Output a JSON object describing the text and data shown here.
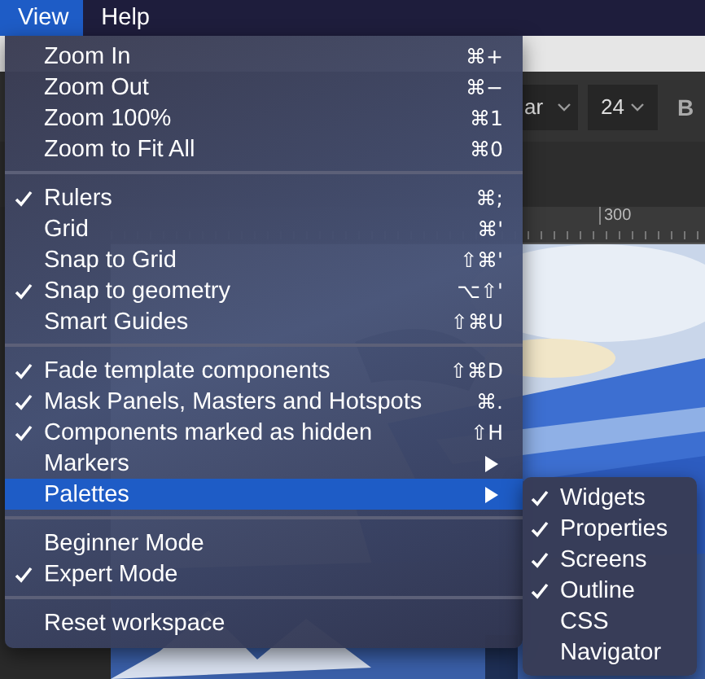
{
  "menubar": [
    {
      "label": "View",
      "selected": true
    },
    {
      "label": "Help",
      "selected": false
    }
  ],
  "toolbar": {
    "font_field": "ar",
    "size_field": "24",
    "bold_button": "B"
  },
  "ruler": {
    "label": "300"
  },
  "menu": {
    "sections": [
      [
        {
          "label": "Zoom In",
          "shortcut": "⌘+",
          "checked": false,
          "has_submenu": false,
          "selected": false
        },
        {
          "label": "Zoom Out",
          "shortcut": "⌘−",
          "checked": false,
          "has_submenu": false,
          "selected": false
        },
        {
          "label": "Zoom 100%",
          "shortcut": "⌘1",
          "checked": false,
          "has_submenu": false,
          "selected": false
        },
        {
          "label": "Zoom to Fit All",
          "shortcut": "⌘0",
          "checked": false,
          "has_submenu": false,
          "selected": false
        }
      ],
      [
        {
          "label": "Rulers",
          "shortcut": "⌘;",
          "checked": true,
          "has_submenu": false,
          "selected": false
        },
        {
          "label": "Grid",
          "shortcut": "⌘'",
          "checked": false,
          "has_submenu": false,
          "selected": false
        },
        {
          "label": "Snap to Grid",
          "shortcut": "⇧⌘'",
          "checked": false,
          "has_submenu": false,
          "selected": false
        },
        {
          "label": "Snap to geometry",
          "shortcut": "⌥⇧'",
          "checked": true,
          "has_submenu": false,
          "selected": false
        },
        {
          "label": "Smart Guides",
          "shortcut": "⇧⌘U",
          "checked": false,
          "has_submenu": false,
          "selected": false
        }
      ],
      [
        {
          "label": "Fade template components",
          "shortcut": "⇧⌘D",
          "checked": true,
          "has_submenu": false,
          "selected": false
        },
        {
          "label": "Mask Panels, Masters and Hotspots",
          "shortcut": "⌘.",
          "checked": true,
          "has_submenu": false,
          "selected": false
        },
        {
          "label": "Components marked as hidden",
          "shortcut": "⇧H",
          "checked": true,
          "has_submenu": false,
          "selected": false
        },
        {
          "label": "Markers",
          "checked": false,
          "has_submenu": true,
          "selected": false
        },
        {
          "label": "Palettes",
          "checked": false,
          "has_submenu": true,
          "selected": true
        }
      ],
      [
        {
          "label": "Beginner Mode",
          "checked": false,
          "has_submenu": false,
          "selected": false
        },
        {
          "label": "Expert Mode",
          "checked": true,
          "has_submenu": false,
          "selected": false
        }
      ],
      [
        {
          "label": "Reset workspace",
          "checked": false,
          "has_submenu": false,
          "selected": false
        }
      ]
    ]
  },
  "submenu": {
    "items": [
      {
        "label": "Widgets",
        "checked": true
      },
      {
        "label": "Properties",
        "checked": true
      },
      {
        "label": "Screens",
        "checked": true
      },
      {
        "label": "Outline",
        "checked": true
      },
      {
        "label": "CSS",
        "checked": false
      },
      {
        "label": "Navigator",
        "checked": false
      }
    ]
  }
}
